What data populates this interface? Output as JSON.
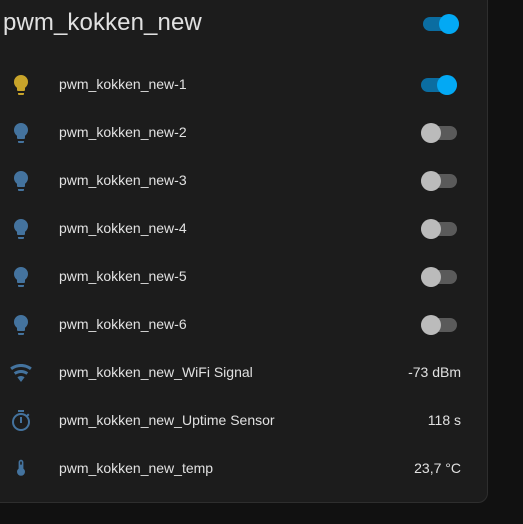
{
  "colors": {
    "light_on": "#c8a42a",
    "light_off": "#44739e",
    "sensor_icon": "#44739e",
    "toggle_on": "#03a9f4",
    "toggle_off": "#bbbbbb"
  },
  "card": {
    "title": "pwm_kokken_new",
    "master_toggle": {
      "state": "on"
    }
  },
  "entities": [
    {
      "icon": "lightbulb-icon",
      "name": "pwm_kokken_new-1",
      "toggle": "on"
    },
    {
      "icon": "lightbulb-icon",
      "name": "pwm_kokken_new-2",
      "toggle": "off"
    },
    {
      "icon": "lightbulb-icon",
      "name": "pwm_kokken_new-3",
      "toggle": "off"
    },
    {
      "icon": "lightbulb-icon",
      "name": "pwm_kokken_new-4",
      "toggle": "off"
    },
    {
      "icon": "lightbulb-icon",
      "name": "pwm_kokken_new-5",
      "toggle": "off"
    },
    {
      "icon": "lightbulb-icon",
      "name": "pwm_kokken_new-6",
      "toggle": "off"
    },
    {
      "icon": "wifi-icon",
      "name": "pwm_kokken_new_WiFi Signal",
      "value": "-73 dBm"
    },
    {
      "icon": "timer-icon",
      "name": "pwm_kokken_new_Uptime Sensor",
      "value": "118 s"
    },
    {
      "icon": "thermometer-icon",
      "name": "pwm_kokken_new_temp",
      "value": "23,7 °C"
    }
  ]
}
